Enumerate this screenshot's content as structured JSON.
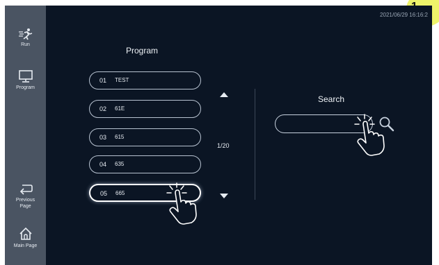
{
  "datetime": "2021/06/29 16:16:2",
  "badge": "1",
  "sidebar": {
    "items": [
      {
        "label": "Run",
        "icon": "run-icon"
      },
      {
        "label": "Program",
        "icon": "monitor-icon"
      },
      {
        "label": "Previous Page",
        "icon": "back-arrow-icon"
      },
      {
        "label": "Main Page",
        "icon": "home-icon"
      }
    ]
  },
  "program": {
    "title": "Program",
    "rows": [
      {
        "number": "01",
        "name": "TEST"
      },
      {
        "number": "02",
        "name": "61E"
      },
      {
        "number": "03",
        "name": "615"
      },
      {
        "number": "04",
        "name": "635"
      },
      {
        "number": "05",
        "name": "665"
      }
    ],
    "page_indicator": "1/20"
  },
  "search": {
    "title": "Search",
    "value": ""
  },
  "colors": {
    "background": "#0b1524",
    "sidebar": "#4a5462",
    "badge": "#eef36a"
  }
}
